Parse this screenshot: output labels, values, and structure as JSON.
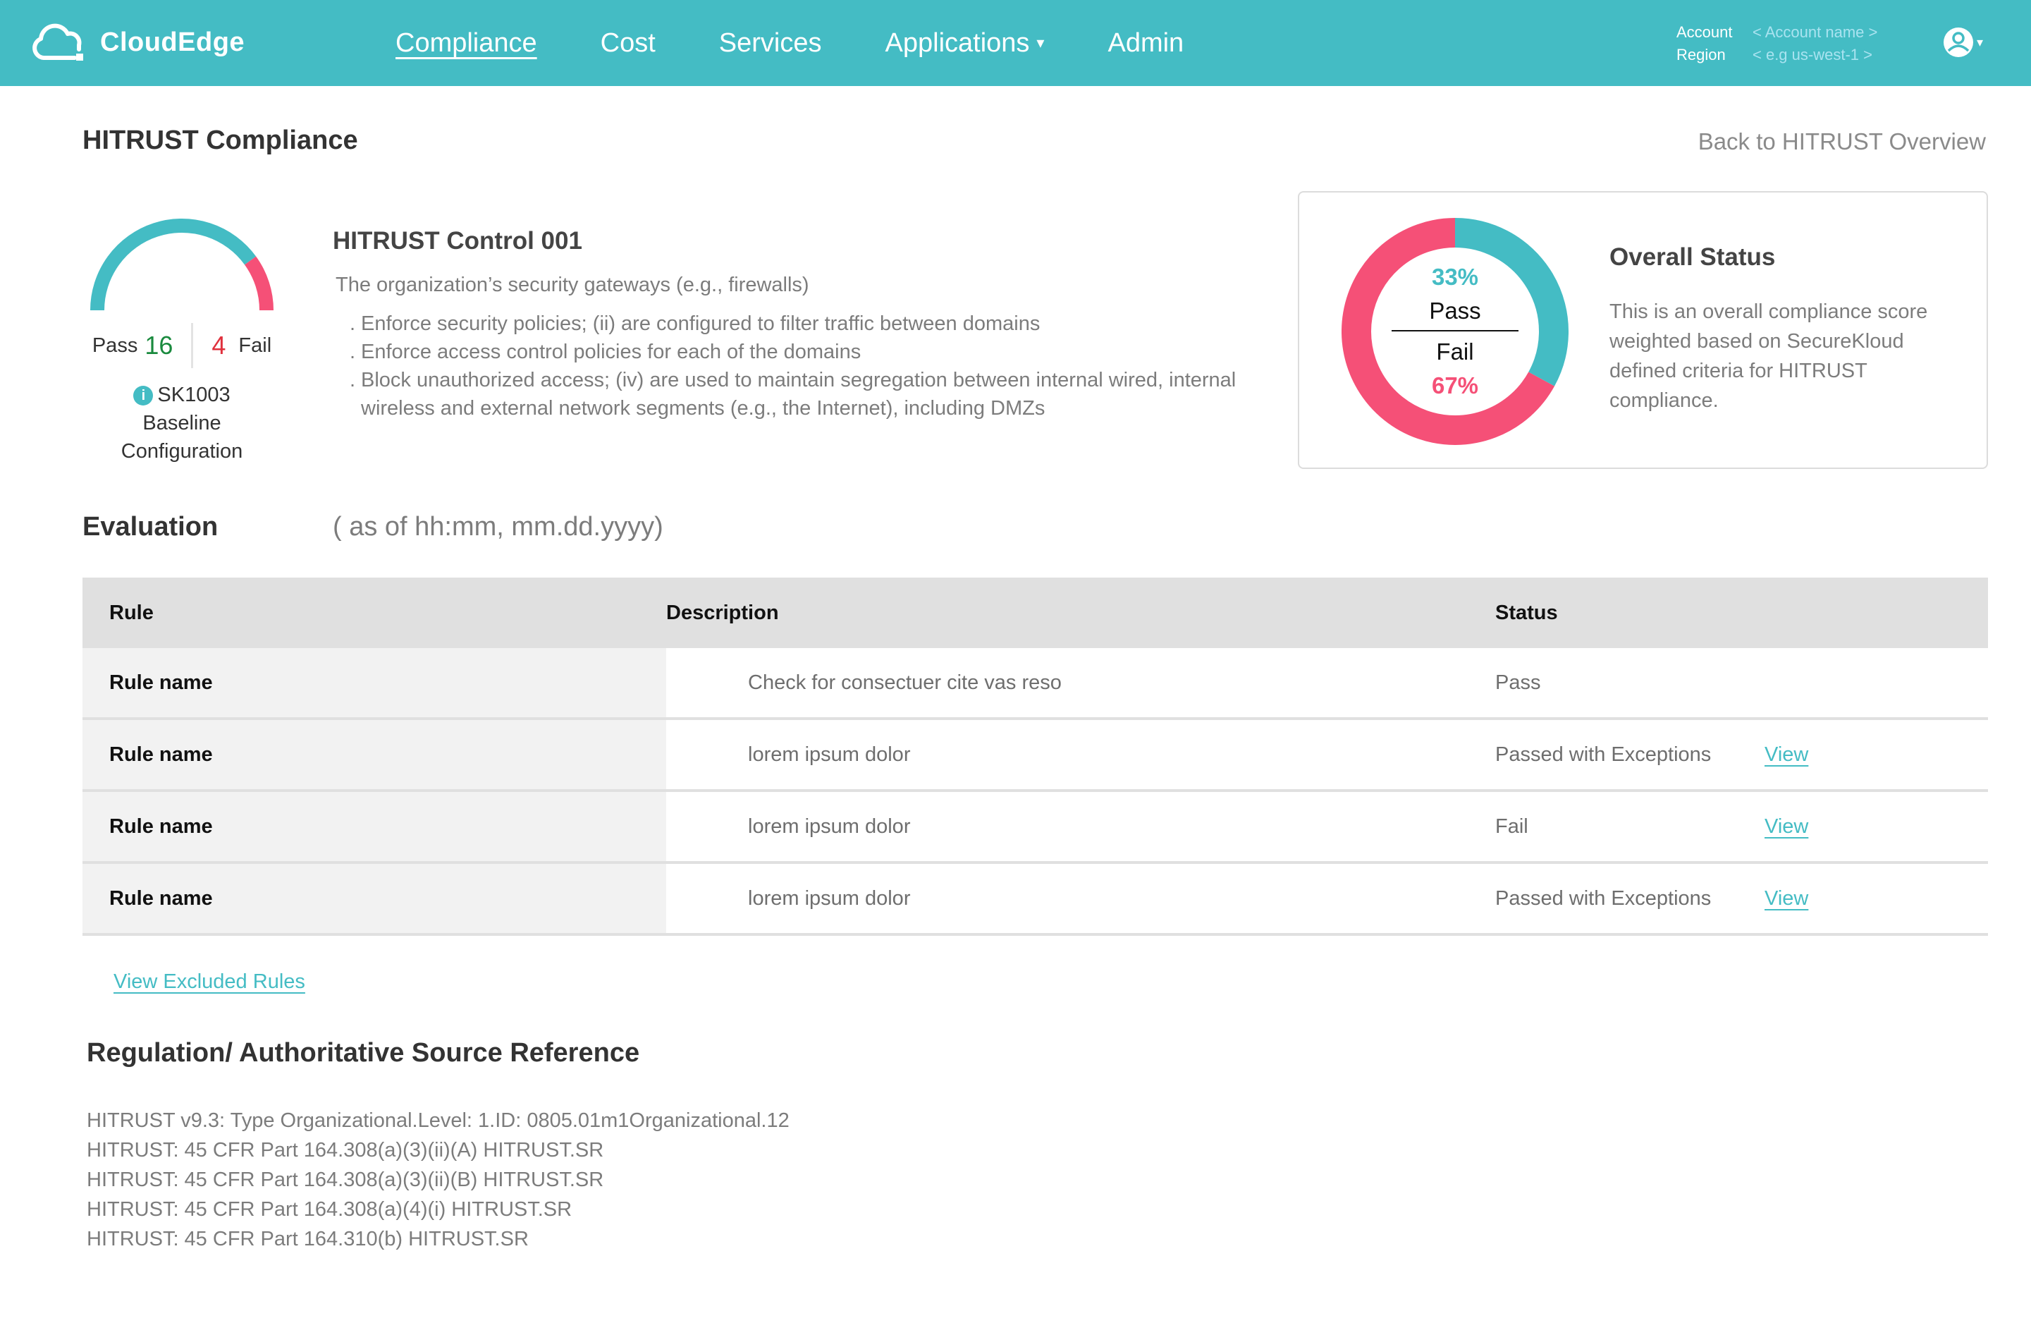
{
  "header": {
    "brand": "CloudEdge",
    "nav": [
      {
        "label": "Compliance",
        "active": true
      },
      {
        "label": "Cost",
        "active": false
      },
      {
        "label": "Services",
        "active": false
      },
      {
        "label": "Applications",
        "active": false,
        "dropdown": true
      },
      {
        "label": "Admin",
        "active": false
      }
    ],
    "dropdown_caret": "▾",
    "account": {
      "label": "Account",
      "value": "< Account name >"
    },
    "region": {
      "label": "Region",
      "value": "<  e.g us-west-1 >"
    },
    "user_caret": "▾"
  },
  "page": {
    "title": "HITRUST Compliance",
    "back_link": "Back to HITRUST Overview"
  },
  "gauge": {
    "pass_label": "Pass",
    "pass_count": "16",
    "fail_label": "Fail",
    "fail_count": "4",
    "pass_fraction": 0.8,
    "rule_id": "SK1003",
    "rule_category": "Baseline Configuration",
    "info_glyph": "i"
  },
  "control": {
    "title": "HITRUST Control 001",
    "description": "The organization’s security gateways (e.g., firewalls)",
    "bullet": ".",
    "items": [
      "Enforce security policies; (ii) are configured to filter traffic between domains",
      "Enforce access control policies for each of the domains",
      "Block unauthorized access; (iv) are used to maintain segregation between internal wired, internal wireless and external network segments (e.g., the Internet), including DMZs"
    ]
  },
  "overall": {
    "title": "Overall Status",
    "text": "This is an overall compliance score weighted based on SecureKloud defined criteria for HITRUST compliance.",
    "pass_pct": "33%",
    "pass_label": "Pass",
    "fail_label": "Fail",
    "fail_pct": "67%",
    "pass_fraction": 0.33
  },
  "colors": {
    "brand": "#44bcc4",
    "fail": "#f55077",
    "pass_count": "#1a8a3e",
    "fail_count": "#e0313d"
  },
  "evaluation": {
    "title": "Evaluation",
    "as_of": "( as of  hh:mm, mm.dd.yyyy)",
    "columns": [
      "Rule",
      "Description",
      "Status"
    ],
    "rows": [
      {
        "rule": "Rule name",
        "description": "Check for consectuer cite vas reso",
        "status": "Pass",
        "action": ""
      },
      {
        "rule": "Rule name",
        "description": "lorem ipsum dolor",
        "status": "Passed with Exceptions",
        "action": "View"
      },
      {
        "rule": "Rule name",
        "description": "lorem ipsum dolor",
        "status": "Fail",
        "action": "View"
      },
      {
        "rule": "Rule name",
        "description": "lorem ipsum dolor",
        "status": "Passed with Exceptions",
        "action": "View"
      }
    ],
    "excluded_link": "View  Excluded Rules"
  },
  "regulation": {
    "title": "Regulation/ Authoritative Source Reference",
    "items": [
      "HITRUST v9.3: Type Organizational.Level: 1.ID: 0805.01m1Organizational.12",
      "HITRUST: 45 CFR Part 164.308(a)(3)(ii)(A) HITRUST.SR",
      "HITRUST: 45 CFR Part 164.308(a)(3)(ii)(B) HITRUST.SR",
      "HITRUST: 45 CFR Part 164.308(a)(4)(i) HITRUST.SR",
      "HITRUST: 45 CFR Part 164.310(b) HITRUST.SR"
    ]
  }
}
